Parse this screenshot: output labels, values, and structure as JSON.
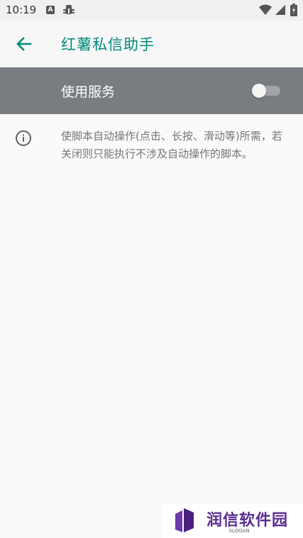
{
  "status_bar": {
    "time": "10:19",
    "notification_icons": [
      "a-box-icon",
      "bug-icon"
    ],
    "system_icons": [
      "wifi-icon",
      "signal-icon",
      "battery-icon"
    ]
  },
  "app_bar": {
    "title": "红薯私信助手",
    "title_color": "#00897b"
  },
  "service": {
    "label": "使用服务",
    "enabled": false,
    "row_color": "#797d82"
  },
  "info": {
    "text": "使脚本自动操作(点击、长按、滑动等)所需，若关闭则只能执行不涉及自动操作的脚本。"
  },
  "watermark": {
    "title": "润信软件园",
    "slogan": "SLOGAN",
    "color": "#5a2d91"
  }
}
